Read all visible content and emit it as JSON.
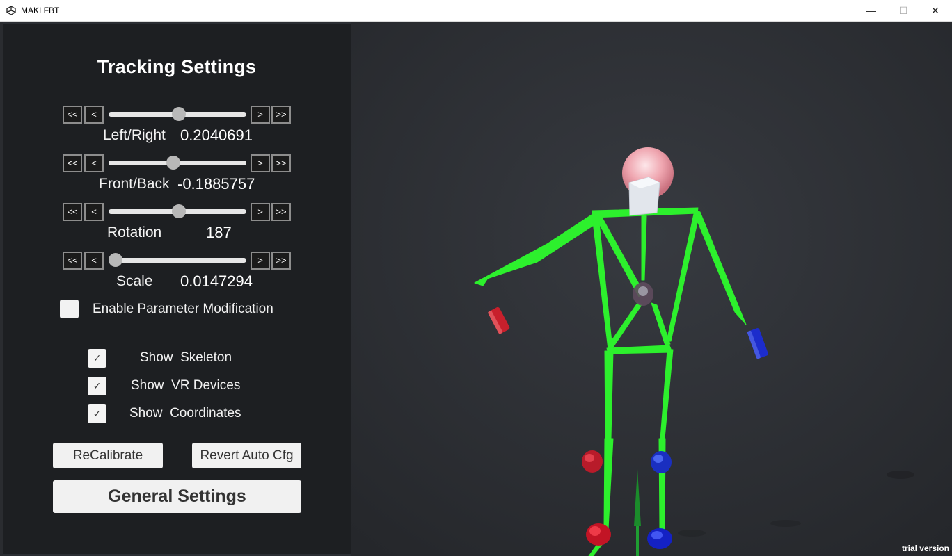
{
  "window": {
    "title": "MAKI FBT",
    "minimize_glyph": "—",
    "maximize_glyph": "☐",
    "close_glyph": "✕",
    "icon": "unity-logo-icon"
  },
  "panel": {
    "title": "Tracking Settings",
    "step_buttons": {
      "big_left": "<<",
      "left": "<",
      "right": ">",
      "big_right": ">>"
    },
    "sliders": [
      {
        "label": "Left/Right",
        "value": "0.2040691",
        "position": 0.51
      },
      {
        "label": "Front/Back",
        "value": "-0.1885757",
        "position": 0.47
      },
      {
        "label": "Rotation",
        "value": "187",
        "position": 0.51
      },
      {
        "label": "Scale",
        "value": "0.0147294",
        "position": 0.05
      }
    ],
    "enable_param": {
      "label": "Enable Parameter Modification",
      "checked": false
    },
    "toggles": [
      {
        "label": "Show  Skeleton",
        "checked": true
      },
      {
        "label": "Show  VR Devices",
        "checked": true
      },
      {
        "label": "Show  Coordinates",
        "checked": true
      }
    ],
    "check_glyph": "✓",
    "buttons": {
      "recalibrate": "ReCalibrate",
      "revert": "Revert Auto Cfg",
      "general": "General Settings"
    }
  },
  "viewport": {
    "watermark": "trial version",
    "skeleton_color": "#2df02d",
    "head_color": "#f2a9b3",
    "left_tracker_color": "#c8202c",
    "right_tracker_color": "#1c2ccc"
  }
}
